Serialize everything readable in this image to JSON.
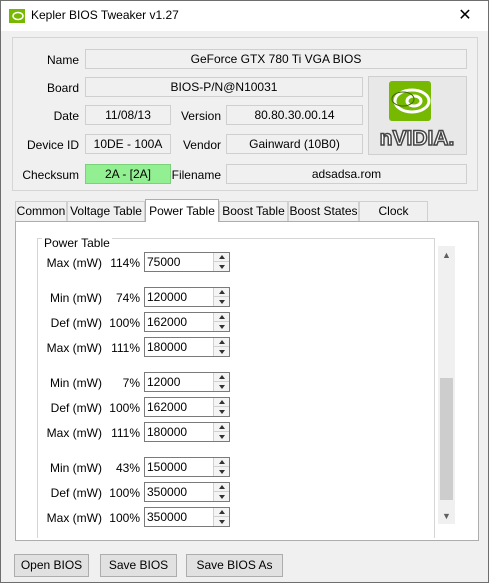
{
  "window": {
    "title": "Kepler BIOS Tweaker v1.27",
    "close_glyph": "✕"
  },
  "info": {
    "name_label": "Name",
    "name_value": "GeForce GTX 780 Ti VGA BIOS",
    "board_label": "Board",
    "board_value": "BIOS-P/N@N10031",
    "date_label": "Date",
    "date_value": "11/08/13",
    "version_label": "Version",
    "version_value": "80.80.30.00.14",
    "device_label": "Device ID",
    "device_value": "10DE - 100A",
    "vendor_label": "Vendor",
    "vendor_value": "Gainward (10B0)",
    "checksum_label": "Checksum",
    "checksum_value": "2A - [2A]",
    "filename_label": "Filename",
    "filename_value": "adsadsa.rom",
    "logo_text": "nVIDIA."
  },
  "tabs": [
    "Common",
    "Voltage Table",
    "Power Table",
    "Boost Table",
    "Boost States",
    "Clock States"
  ],
  "active_tab": "Power Table",
  "power_table": {
    "legend": "Power Table",
    "rows": [
      {
        "label": "Max (mW)",
        "pct": "114%",
        "value": "75000"
      },
      {
        "label": "Min (mW)",
        "pct": "74%",
        "value": "120000"
      },
      {
        "label": "Def (mW)",
        "pct": "100%",
        "value": "162000"
      },
      {
        "label": "Max (mW)",
        "pct": "111%",
        "value": "180000"
      },
      {
        "label": "Min (mW)",
        "pct": "7%",
        "value": "12000"
      },
      {
        "label": "Def (mW)",
        "pct": "100%",
        "value": "162000"
      },
      {
        "label": "Max (mW)",
        "pct": "111%",
        "value": "180000"
      },
      {
        "label": "Min (mW)",
        "pct": "43%",
        "value": "150000"
      },
      {
        "label": "Def (mW)",
        "pct": "100%",
        "value": "350000"
      },
      {
        "label": "Max (mW)",
        "pct": "100%",
        "value": "350000"
      }
    ]
  },
  "buttons": {
    "open": "Open BIOS",
    "save": "Save BIOS",
    "save_as": "Save BIOS As"
  },
  "colors": {
    "checksum_ok": "#92ef92",
    "nvidia_green": "#76b900"
  }
}
